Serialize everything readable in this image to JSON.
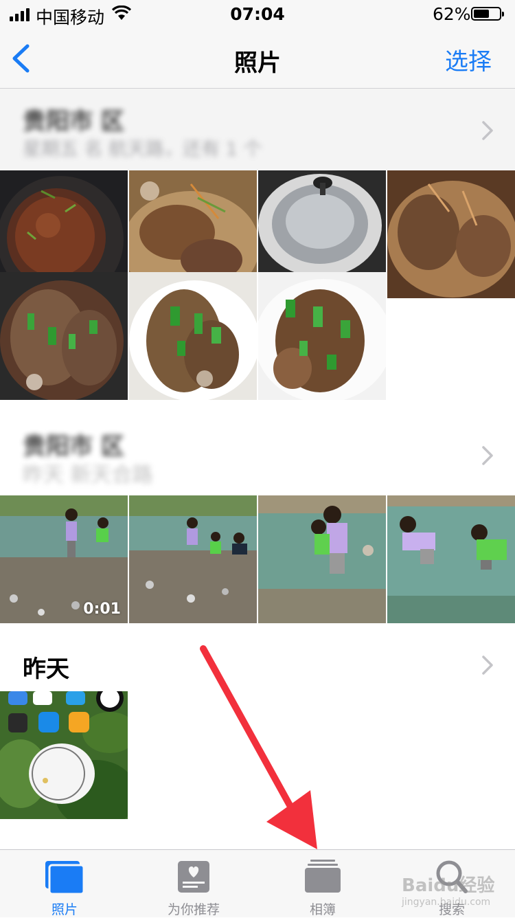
{
  "status_bar": {
    "carrier": "中国移动",
    "time": "07:04",
    "battery": "62%",
    "battery_level": 0.62
  },
  "nav": {
    "back_icon": "chevron-left-icon",
    "title": "照片",
    "select_label": "选择"
  },
  "sections": [
    {
      "title": "贵阳市  区",
      "subtitle": "星期五  名  航天路，还有 1 个",
      "obscured": true,
      "photos": [
        "wok-soup",
        "fish-stew",
        "pot-lid",
        "fish-closeup",
        "fish-wok",
        "fish-plate",
        "fish-plate-2"
      ]
    },
    {
      "title": "贵阳市  区",
      "subtitle": "昨天  新天合路",
      "obscured": true,
      "photos": [
        "kids-river-video",
        "kids-river",
        "kids-river-close",
        "kids-river-play"
      ],
      "video_duration": "0:01"
    },
    {
      "title": "昨天",
      "subtitle": "",
      "obscured": false,
      "photos": [
        "screenshot-flower"
      ]
    }
  ],
  "tab_bar": {
    "tabs": [
      {
        "label": "照片",
        "icon": "photos-tab-icon",
        "active": true
      },
      {
        "label": "为你推荐",
        "icon": "for-you-tab-icon",
        "active": false
      },
      {
        "label": "相簿",
        "icon": "albums-tab-icon",
        "active": false
      },
      {
        "label": "搜索",
        "icon": "search-tab-icon",
        "active": false
      }
    ]
  },
  "watermark": {
    "text": "Baidu经验",
    "sub": "jingyan.baidu.com"
  },
  "colors": {
    "accent": "#1a7cf5",
    "arrow": "#f2303c",
    "inactive": "#8e8e93"
  }
}
